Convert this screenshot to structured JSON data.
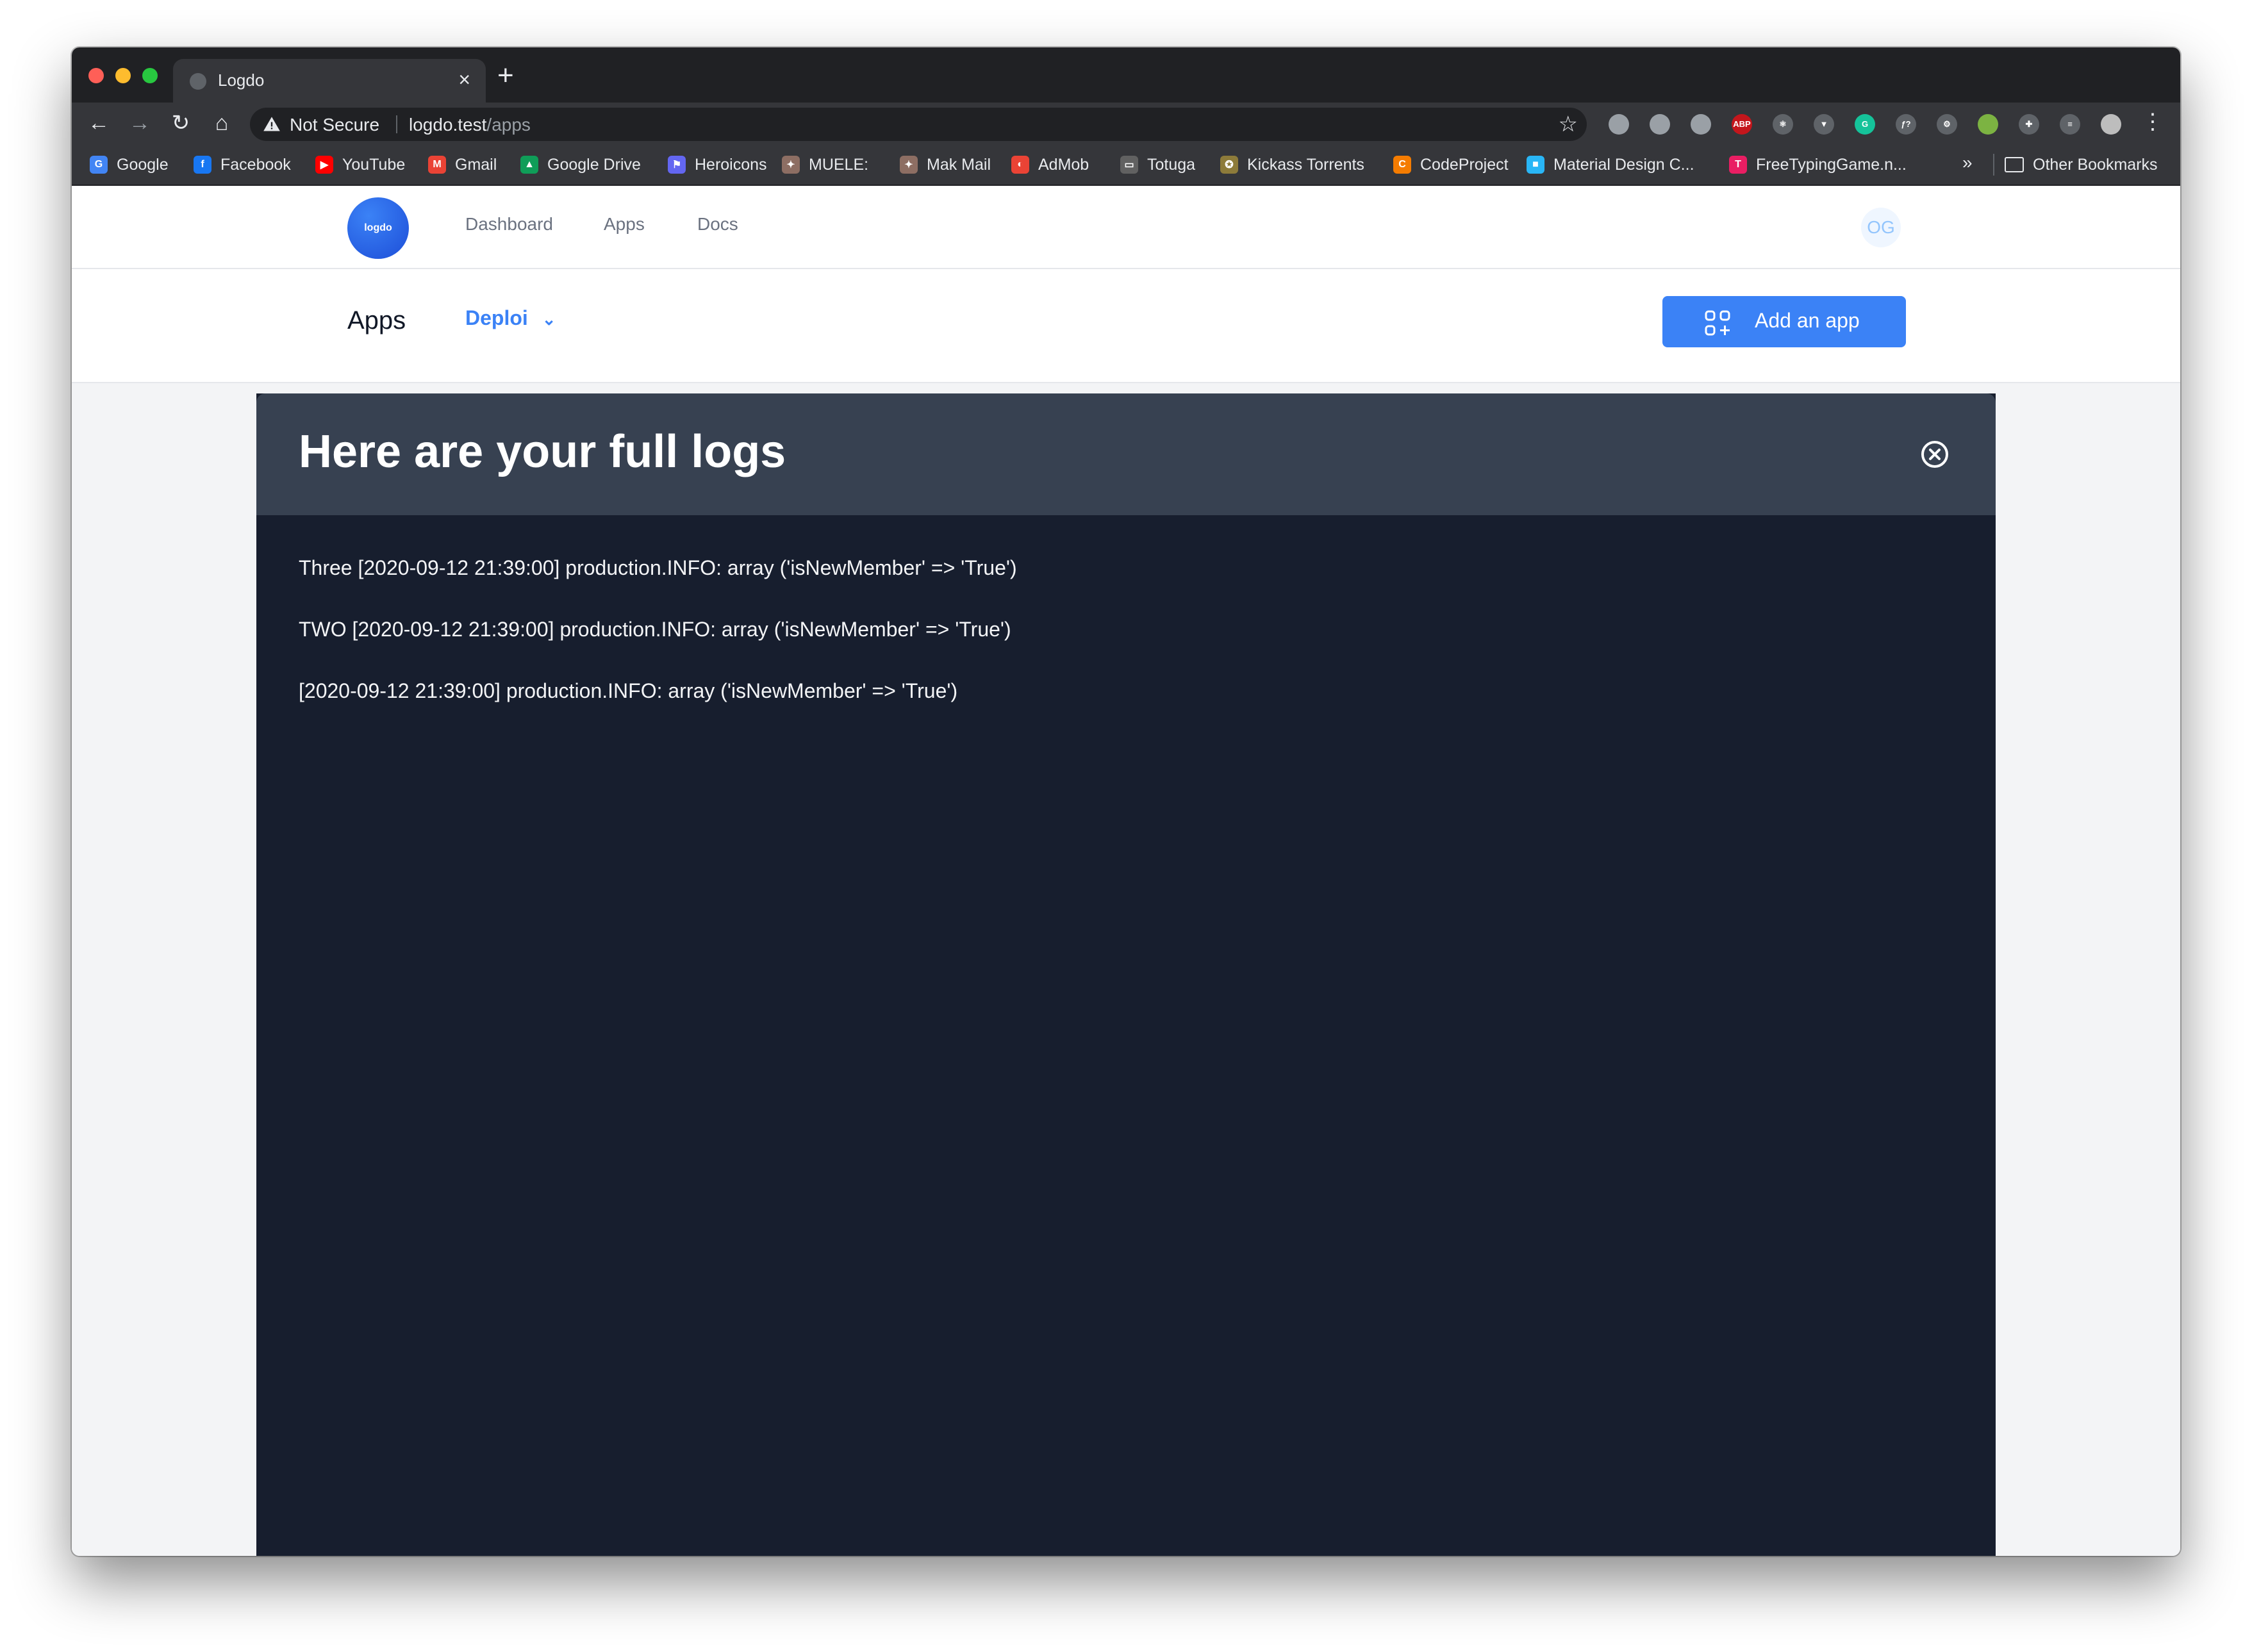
{
  "browser": {
    "tab_title": "Logdo",
    "tab_close": "×",
    "new_tab": "+",
    "security_label": "Not Secure",
    "url_host": "logdo.test",
    "url_path": "/apps",
    "nav": {
      "back": "←",
      "forward": "→",
      "reload": "↻",
      "home": "⌂"
    },
    "star": "☆",
    "menu": "⋮",
    "extensions": [
      {
        "name": "ext-1",
        "color": "#9aa0a6",
        "text": ""
      },
      {
        "name": "ext-2",
        "color": "#9aa0a6",
        "text": ""
      },
      {
        "name": "ext-camera",
        "color": "#9aa0a6",
        "text": ""
      },
      {
        "name": "ext-abp",
        "color": "#c4161c",
        "text": "ABP"
      },
      {
        "name": "ext-react",
        "color": "#5f6368",
        "text": "⚛"
      },
      {
        "name": "ext-vue",
        "color": "#5f6368",
        "text": "▼"
      },
      {
        "name": "ext-grammarly",
        "color": "#15c39a",
        "text": "G"
      },
      {
        "name": "ext-fx",
        "color": "#5f6368",
        "text": "ƒ?"
      },
      {
        "name": "ext-gear",
        "color": "#5f6368",
        "text": "⚙"
      },
      {
        "name": "ext-green",
        "color": "#7cb342",
        "text": ""
      },
      {
        "name": "ext-puzzle",
        "color": "#5f6368",
        "text": "✚"
      },
      {
        "name": "ext-queue",
        "color": "#5f6368",
        "text": "≡"
      },
      {
        "name": "ext-profile",
        "color": "#bdbdbd",
        "text": ""
      }
    ]
  },
  "bookmarks": {
    "items": [
      {
        "label": "Google",
        "icon": "G",
        "color": "#4285f4"
      },
      {
        "label": "Facebook",
        "icon": "f",
        "color": "#1877f2"
      },
      {
        "label": "YouTube",
        "icon": "▶",
        "color": "#ff0000"
      },
      {
        "label": "Gmail",
        "icon": "M",
        "color": "#ea4335"
      },
      {
        "label": "Google Drive",
        "icon": "▲",
        "color": "#0f9d58"
      },
      {
        "label": "Heroicons",
        "icon": "⚑",
        "color": "#6366f1"
      },
      {
        "label": "MUELE:",
        "icon": "✦",
        "color": "#8d6e63"
      },
      {
        "label": "Mak Mail",
        "icon": "✦",
        "color": "#8d6e63"
      },
      {
        "label": "AdMob",
        "icon": "◐",
        "color": "#ea4335"
      },
      {
        "label": "Totuga",
        "icon": "▭",
        "color": "#616161"
      },
      {
        "label": "Kickass Torrents",
        "icon": "✪",
        "color": "#8d7b3a"
      },
      {
        "label": "CodeProject",
        "icon": "C",
        "color": "#f57c00"
      },
      {
        "label": "Material Design C...",
        "icon": "■",
        "color": "#29b6f6"
      },
      {
        "label": "FreeTypingGame.n...",
        "icon": "T",
        "color": "#e91e63"
      }
    ],
    "more": "»",
    "other": "Other Bookmarks"
  },
  "app": {
    "logo_text": "logdo",
    "nav": [
      "Dashboard",
      "Apps",
      "Docs"
    ],
    "avatar_initials": "OG",
    "page_title": "Apps",
    "selected_app": "Deploi",
    "add_button_label": "Add an app"
  },
  "modal": {
    "title": "Here are your full logs",
    "logs": [
      "Three [2020-09-12 21:39:00] production.INFO: array ('isNewMember' => 'True')",
      "TWO [2020-09-12 21:39:00] production.INFO: array ('isNewMember' => 'True')",
      "[2020-09-12 21:39:00] production.INFO: array ('isNewMember' => 'True')"
    ]
  }
}
